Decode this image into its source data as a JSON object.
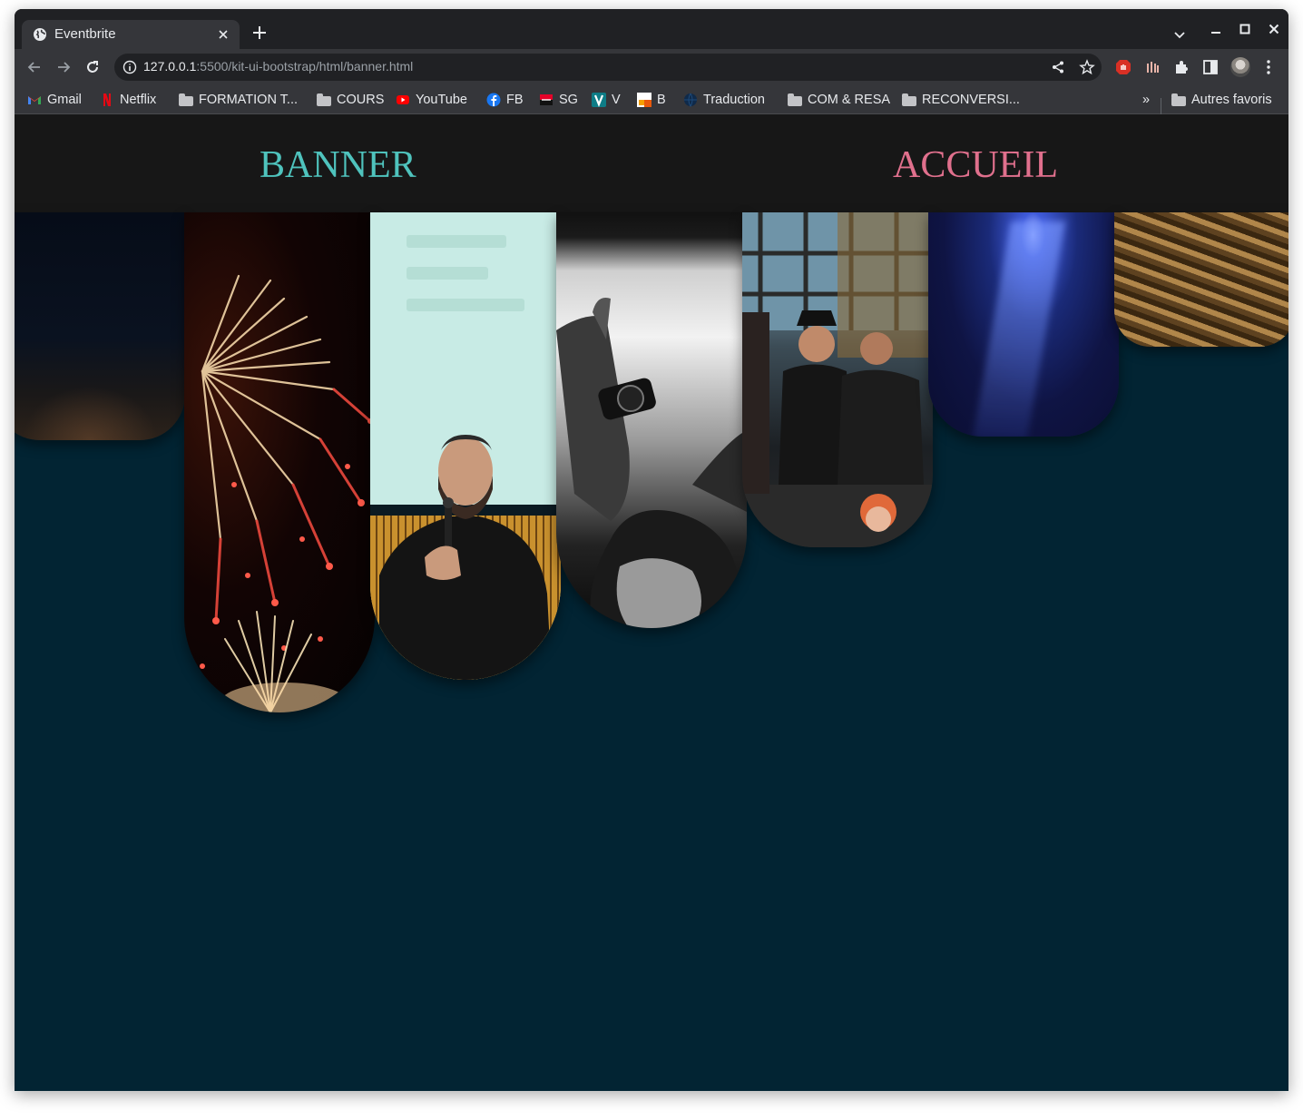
{
  "browser": {
    "tab_title": "Eventbrite",
    "url_host": "127.0.0.1",
    "url_rest": ":5500/kit-ui-bootstrap/html/banner.html"
  },
  "bookmarks": [
    {
      "label": "Gmail",
      "icon": "gmail-icon"
    },
    {
      "label": "Netflix",
      "icon": "netflix-icon"
    },
    {
      "label": "FORMATION T...",
      "icon": "folder-icon"
    },
    {
      "label": "COURS",
      "icon": "folder-icon"
    },
    {
      "label": "YouTube",
      "icon": "youtube-icon"
    },
    {
      "label": "FB",
      "icon": "facebook-icon"
    },
    {
      "label": "SG",
      "icon": "sg-icon"
    },
    {
      "label": "V",
      "icon": "v-icon"
    },
    {
      "label": "B",
      "icon": "b-icon"
    },
    {
      "label": "Traduction",
      "icon": "globe-icon"
    },
    {
      "label": "COM & RESA",
      "icon": "folder-icon"
    },
    {
      "label": "RECONVERSI...",
      "icon": "folder-icon"
    }
  ],
  "bookmarks_overflow": "»",
  "other_bookmarks": "Autres favoris",
  "page": {
    "nav_banner": "BANNER",
    "nav_accueil": "ACCUEIL",
    "background_color": "#022433",
    "banner_color": "#4fc3bd",
    "accueil_color": "#e0708d"
  }
}
